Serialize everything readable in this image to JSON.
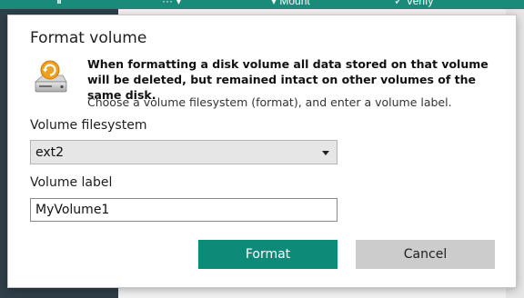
{
  "app": {
    "toolbar": {
      "item_mount": "Mount",
      "item_verify": "Verify"
    }
  },
  "dialog": {
    "title": "Format volume",
    "warning": "When formatting a disk volume all data stored on that volume will be deleted, but remained intact on other volumes of the same disk.",
    "help": "Choose a volume filesystem (format), and enter a volume label.",
    "filesystem_label": "Volume filesystem",
    "filesystem_value": "ext2",
    "volume_label_label": "Volume label",
    "volume_label_value": "MyVolume1",
    "format_button": "Format",
    "cancel_button": "Cancel",
    "icon": "disk-format-icon"
  },
  "colors": {
    "accent": "#0e8a78",
    "toolbar": "#1a8a7a",
    "sidebar": "#2f3e48",
    "cancel": "#cccccc"
  }
}
